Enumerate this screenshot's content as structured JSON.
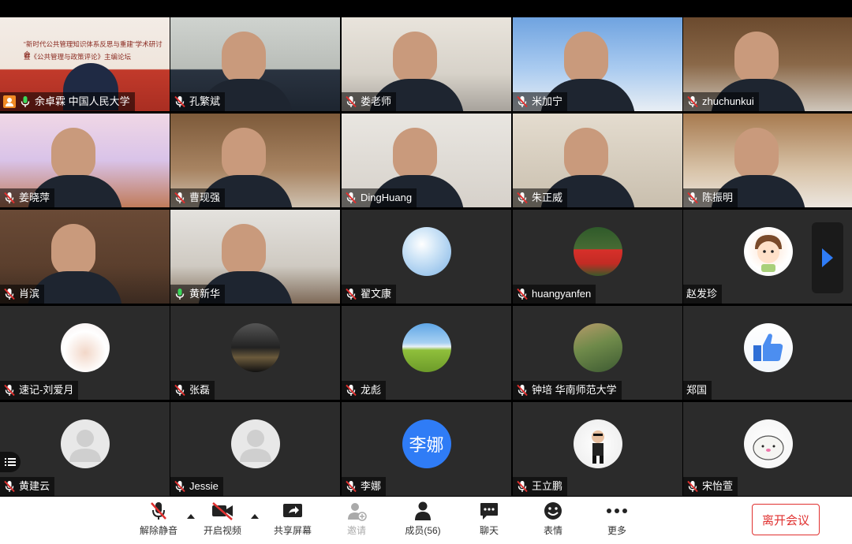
{
  "participants": [
    {
      "name": "余卓霖 中国人民大学",
      "mic": "on",
      "presenter": true,
      "video": "slide",
      "slide_line1": "“新时代公共管理知识体系反思与重建”学术研讨会",
      "slide_line2": "暨《公共管理与政策评论》主编论坛"
    },
    {
      "name": "孔繁斌",
      "mic": "muted",
      "video": "camera"
    },
    {
      "name": "娄老师",
      "mic": "muted",
      "video": "camera"
    },
    {
      "name": "米加宁",
      "mic": "muted",
      "video": "camera"
    },
    {
      "name": "zhuchunkui",
      "mic": "muted",
      "video": "camera"
    },
    {
      "name": "姜晓萍",
      "mic": "muted",
      "video": "camera"
    },
    {
      "name": "曹现强",
      "mic": "muted",
      "video": "camera"
    },
    {
      "name": "DingHuang",
      "mic": "muted",
      "video": "camera"
    },
    {
      "name": "朱正威",
      "mic": "muted",
      "video": "camera"
    },
    {
      "name": "陈振明",
      "mic": "muted",
      "video": "camera"
    },
    {
      "name": "肖滨",
      "mic": "muted",
      "video": "camera"
    },
    {
      "name": "黄新华",
      "mic": "on",
      "video": "camera"
    },
    {
      "name": "翟文康",
      "mic": "muted",
      "video": "avatar",
      "avatar": "sky-photo"
    },
    {
      "name": "huangyanfen",
      "mic": "muted",
      "video": "avatar",
      "avatar": "tulip-photo"
    },
    {
      "name": "赵发珍",
      "mic": "none",
      "video": "avatar",
      "avatar": "cartoon-photo"
    },
    {
      "name": "速记-刘爱月",
      "mic": "muted",
      "video": "avatar",
      "avatar": "badge-photo"
    },
    {
      "name": "张磊",
      "mic": "muted",
      "video": "avatar",
      "avatar": "sunset-photo"
    },
    {
      "name": "龙彪",
      "mic": "muted",
      "video": "avatar",
      "avatar": "field-photo"
    },
    {
      "name": "钟培 华南师范大学",
      "mic": "muted",
      "video": "avatar",
      "avatar": "painting-photo"
    },
    {
      "name": "郑国",
      "mic": "none",
      "video": "avatar",
      "avatar": "thumbs-up-photo"
    },
    {
      "name": "黄建云",
      "mic": "muted",
      "video": "avatar",
      "avatar": "default-avatar"
    },
    {
      "name": "Jessie",
      "mic": "muted",
      "video": "avatar",
      "avatar": "default-avatar"
    },
    {
      "name": "李娜",
      "mic": "muted",
      "video": "avatar",
      "avatar": "text",
      "avatar_text": "李娜"
    },
    {
      "name": "王立鹏",
      "mic": "muted",
      "video": "avatar",
      "avatar": "child-photo"
    },
    {
      "name": "宋怡萱",
      "mic": "muted",
      "video": "avatar",
      "avatar": "seal-cartoon"
    }
  ],
  "toolbar": {
    "unmute": "解除静音",
    "start_video": "开启视频",
    "share_screen": "共享屏幕",
    "invite": "邀请",
    "members": "成员(56)",
    "chat": "聊天",
    "reactions": "表情",
    "more": "更多",
    "leave": "离开会议"
  },
  "colors": {
    "accent_red": "#e0302f",
    "active_speaker": "#3ad85a",
    "mute_red": "#e0302f",
    "avatar_blue": "#2f7cf6"
  }
}
